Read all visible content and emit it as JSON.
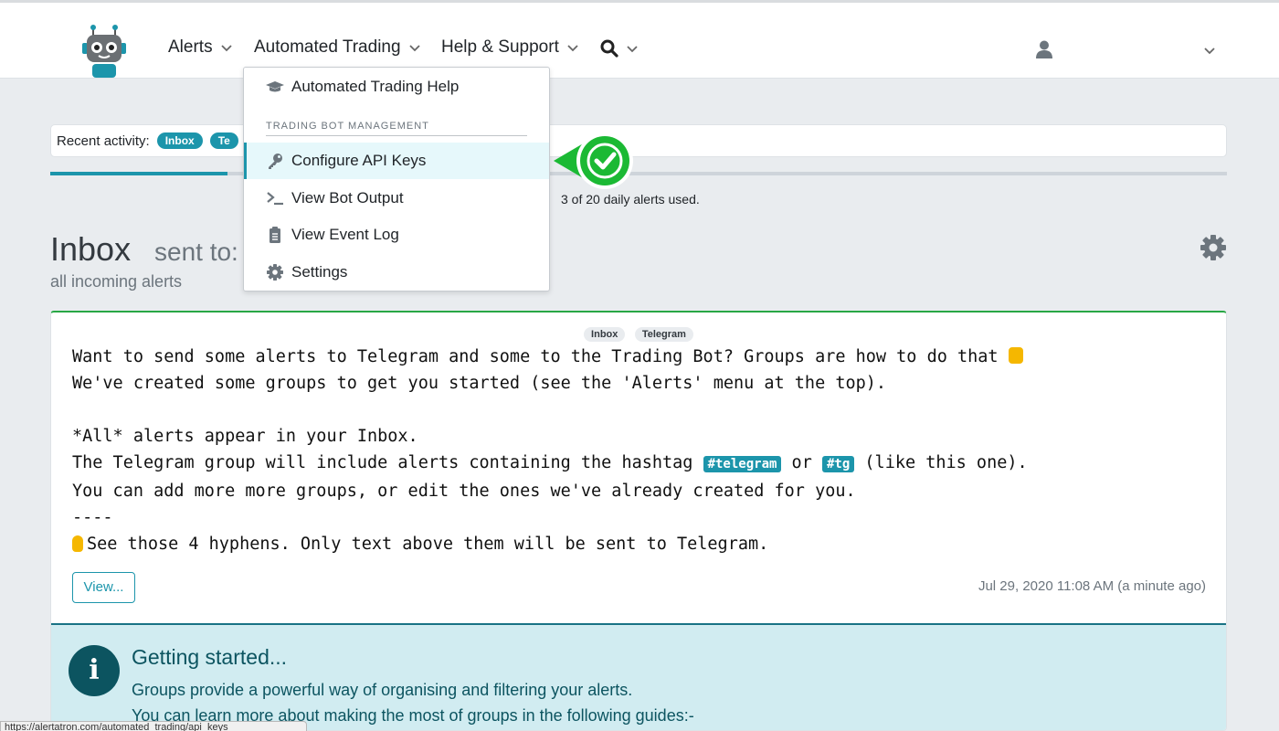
{
  "nav": {
    "alerts": "Alerts",
    "automated_trading": "Automated Trading",
    "help": "Help & Support",
    "brand_color": "#1c95ab"
  },
  "dropdown": {
    "help_item": "Automated Trading Help",
    "section_header": "TRADING BOT MANAGEMENT",
    "items": [
      {
        "label": "Configure API Keys",
        "icon": "key-icon",
        "active": true
      },
      {
        "label": "View Bot Output",
        "icon": "terminal-icon"
      },
      {
        "label": "View Event Log",
        "icon": "clipboard-icon"
      },
      {
        "label": "Settings",
        "icon": "gear-icon"
      }
    ]
  },
  "recent": {
    "label": "Recent activity:",
    "pills": [
      "Inbox",
      "Te"
    ]
  },
  "alerts_used": "3 of 20 daily alerts used.",
  "inbox": {
    "title": "Inbox",
    "sent_to": "sent to:",
    "subtitle": "all incoming alerts"
  },
  "alert": {
    "tags": [
      "Inbox",
      "Telegram"
    ],
    "line1": "Want to send some alerts to Telegram and some to the Trading Bot? Groups are how to do that ",
    "line2": "We've created some groups to get you started (see the 'Alerts' menu at the top).",
    "line3": "*All* alerts appear in your Inbox.",
    "line4_a": "The Telegram group will include alerts containing the hashtag ",
    "hashtag1": "#telegram",
    "line4_b": " or ",
    "hashtag2": "#tg",
    "line4_c": " (like this one).",
    "line5": "You can add more more groups, or edit the ones we've already created for you.",
    "line6": "----",
    "line7": "See those 4 hyphens. Only text above them will be sent to Telegram.",
    "view_button": "View...",
    "timestamp": "Jul 29, 2020 11:08 AM (a minute ago)"
  },
  "info": {
    "title": "Getting started...",
    "line1": "Groups provide a powerful way of organising and filtering your alerts.",
    "line2": "You can learn more about making the most of groups in the following guides:-"
  },
  "statusbar": "https://alertatron.com/automated_trading/api_keys"
}
